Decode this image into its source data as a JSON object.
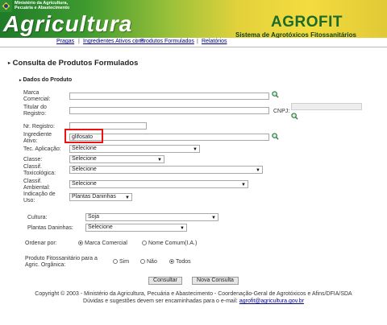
{
  "header": {
    "ministry_line1": "Ministério da Agricultura,",
    "ministry_line2": "Pecuária e Abastecimento",
    "title": "Agricultura",
    "logo": "AGROFIT",
    "subsystem": "Sistema de Agrotóxicos Fitossanitários"
  },
  "nav": {
    "items": [
      "Pragas",
      "Ingredientes Ativos cons",
      "Produtos Formulados",
      "Relatórios"
    ],
    "separator": "|"
  },
  "page": {
    "title": "Consulta de Produtos Formulados",
    "section": "Dados do Produto"
  },
  "form": {
    "marca_comercial_l1": "Marca",
    "marca_comercial_l2": "Comercial:",
    "titular_l1": "Titular do",
    "titular_l2": "Registro:",
    "cnpj": "CNPJ:",
    "nr_registro": "Nr. Registro:",
    "ingrediente_l1": "Ingrediente",
    "ingrediente_l2": "Ativo:",
    "ingrediente_value": "glifosato",
    "tec_aplicacao": "Tec. Aplicação:",
    "tec_aplicacao_value": "Selecione",
    "classe": "Classe:",
    "classe_value": "Selecione",
    "tox_l1": "Classif.",
    "tox_l2": "Toxicológica:",
    "tox_value": "Selecione",
    "amb_l1": "Classif.",
    "amb_l2": "Ambiental:",
    "amb_value": "Selecione",
    "uso_l1": "Indicação de",
    "uso_l2": "Uso:",
    "uso_value": "Plantas Daninhas",
    "cultura": "Cultura:",
    "cultura_value": "Soja",
    "plantas_daninhas": "Plantas Daninhas:",
    "plantas_daninhas_value": "Selecione",
    "ordenar_por": "Ordenar por:",
    "ordenar_options": [
      "Marca Comercial",
      "Nome Comum(I.A.)"
    ],
    "organica_l1": "Produto Fitossanitário para a",
    "organica_l2": "Agric. Orgânica:",
    "organica_options": [
      "Sim",
      "Não",
      "Todos"
    ],
    "consultar": "Consultar",
    "nova_consulta": "Nova Consulta"
  },
  "footer": {
    "line1": "Copyright © 2003 - Ministério da Agricultura, Pecuária e Abastecimento - Coordenação-Geral de Agrotóxicos e Afins/DFIA/SDA",
    "line2_prefix": "Dúvidas e sugestões devem ser encaminhadas para o e-mail: ",
    "email": "agrofit@agricultura.gov.br"
  },
  "colors": {
    "banner_green": "#1f7a2a",
    "banner_yellow": "#f3dc3e",
    "link": "#00008b",
    "highlight": "#e11111"
  }
}
